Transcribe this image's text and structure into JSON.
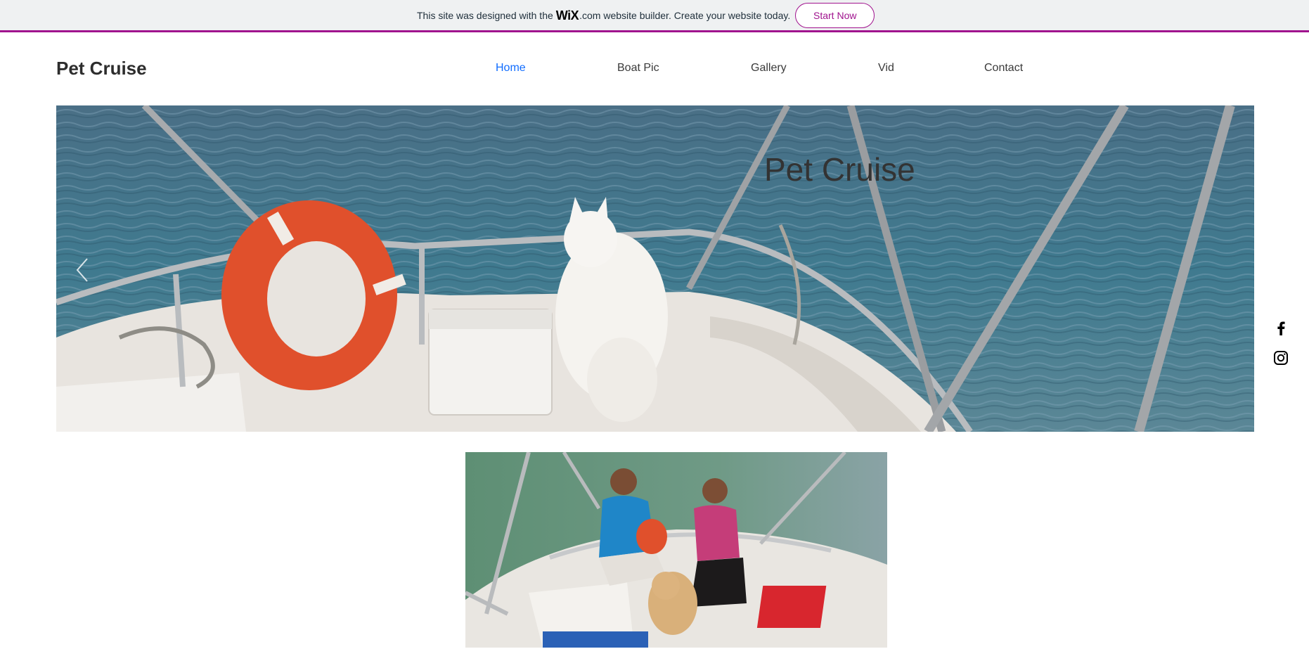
{
  "banner": {
    "text_before": "This site was designed with the",
    "wix_logo": "WiX",
    "text_after": ".com website builder. Create your website today.",
    "cta_label": "Start Now",
    "accent_color": "#a0138e"
  },
  "header": {
    "site_title": "Pet Cruise"
  },
  "nav": {
    "items": [
      {
        "label": "Home",
        "active": true
      },
      {
        "label": "Boat Pic",
        "active": false
      },
      {
        "label": "Gallery",
        "active": false
      },
      {
        "label": "Vid",
        "active": false
      },
      {
        "label": "Contact",
        "active": false
      }
    ],
    "active_color": "#116dff"
  },
  "hero": {
    "title": "Pet Cruise",
    "image_description_icon": "boat-dog-photo",
    "prev_arrow_icon": "chevron-left-icon"
  },
  "social": {
    "icons": [
      "facebook-icon",
      "instagram-icon"
    ]
  },
  "gallery_photo": {
    "image_icon": "couple-dog-boat-photo"
  }
}
